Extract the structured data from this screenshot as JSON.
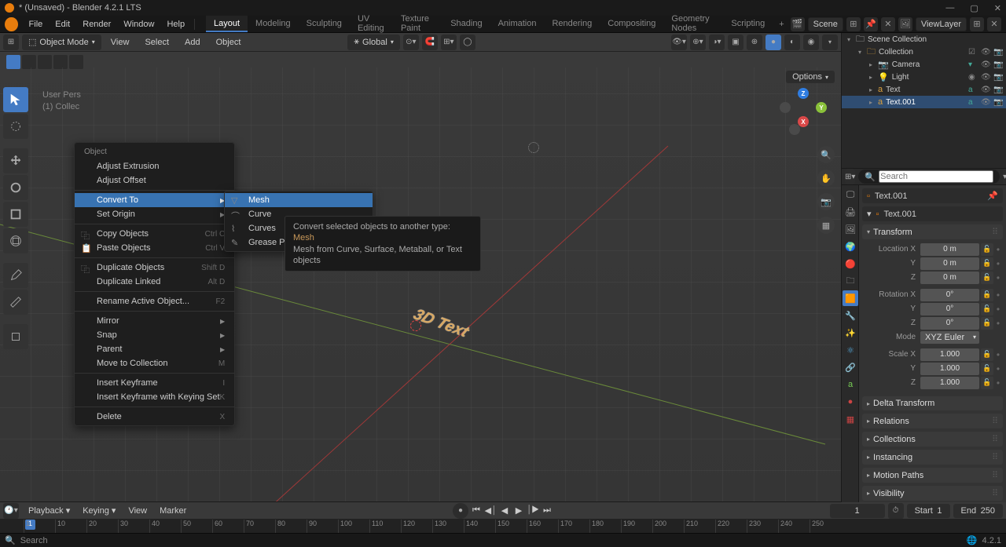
{
  "titlebar": {
    "title": "* (Unsaved) - Blender 4.2.1 LTS"
  },
  "topmenu": {
    "file": "File",
    "edit": "Edit",
    "render": "Render",
    "window": "Window",
    "help": "Help"
  },
  "workspaces": [
    "Layout",
    "Modeling",
    "Sculpting",
    "UV Editing",
    "Texture Paint",
    "Shading",
    "Animation",
    "Rendering",
    "Compositing",
    "Geometry Nodes",
    "Scripting"
  ],
  "active_workspace": 0,
  "scene": {
    "label": "Scene"
  },
  "viewlayer": {
    "label": "ViewLayer"
  },
  "viewport_header": {
    "mode": "Object Mode",
    "menus": [
      "View",
      "Select",
      "Add",
      "Object"
    ],
    "orientation": "Global",
    "options": "Options",
    "search_placeholder": "Search"
  },
  "persp": {
    "line1": "User Pers",
    "line2": "(1) Collec"
  },
  "left_tools": [
    "select-box",
    "cursor",
    "move",
    "rotate",
    "scale",
    "transform",
    "annotate",
    "measure",
    "add-primitive"
  ],
  "ctx_menu": {
    "header": "Object",
    "items_top": [
      {
        "label": "Adjust Extrusion"
      },
      {
        "label": "Adjust Offset"
      }
    ],
    "convert": "Convert To",
    "setorigin": "Set Origin",
    "items_mid": [
      {
        "label": "Copy Objects",
        "shortcut": "Ctrl C",
        "icon": "copy"
      },
      {
        "label": "Paste Objects",
        "shortcut": "Ctrl V",
        "icon": "paste"
      },
      {
        "label": "Duplicate Objects",
        "shortcut": "Shift D",
        "icon": "dup"
      },
      {
        "label": "Duplicate Linked",
        "shortcut": "Alt D"
      },
      {
        "label": "Rename Active Object...",
        "shortcut": "F2"
      }
    ],
    "items_sub": [
      {
        "label": "Mirror"
      },
      {
        "label": "Snap"
      },
      {
        "label": "Parent"
      },
      {
        "label": "Move to Collection",
        "shortcut": "M"
      }
    ],
    "items_key": [
      {
        "label": "Insert Keyframe",
        "shortcut": "I"
      },
      {
        "label": "Insert Keyframe with Keying Set",
        "shortcut": "K"
      }
    ],
    "delete": {
      "label": "Delete",
      "shortcut": "X"
    }
  },
  "submenu": {
    "items": [
      {
        "label": "Mesh",
        "icon": "mesh"
      },
      {
        "label": "Curve",
        "icon": "curve"
      },
      {
        "label": "Curves",
        "icon": "curves"
      },
      {
        "label": "Grease Pencil",
        "icon": "gp"
      }
    ]
  },
  "tooltip": {
    "line1a": "Convert selected objects to another type:  ",
    "line1b": "Mesh",
    "line2": "Mesh from Curve, Surface, Metaball, or Text objects"
  },
  "outliner": {
    "root": "Scene Collection",
    "collection": "Collection",
    "items": [
      {
        "name": "Camera",
        "icon": "camera"
      },
      {
        "name": "Light",
        "icon": "light"
      },
      {
        "name": "Text",
        "icon": "text"
      },
      {
        "name": "Text.001",
        "icon": "text",
        "selected": true
      }
    ]
  },
  "props": {
    "search_placeholder": "Search",
    "breadcrumb1": "Text.001",
    "breadcrumb2": "Text.001",
    "transform": "Transform",
    "location": "Location X",
    "rotation": "Rotation X",
    "scale": "Scale X",
    "y": "Y",
    "z": "Z",
    "mode_label": "Mode",
    "mode_value": "XYZ Euler",
    "loc_vals": [
      "0 m",
      "0 m",
      "0 m"
    ],
    "rot_vals": [
      "0°",
      "0°",
      "0°"
    ],
    "scale_vals": [
      "1.000",
      "1.000",
      "1.000"
    ],
    "sections": [
      "Delta Transform",
      "Relations",
      "Collections",
      "Instancing",
      "Motion Paths",
      "Visibility"
    ]
  },
  "timeline": {
    "playback": "Playback",
    "keying": "Keying",
    "view": "View",
    "marker": "Marker",
    "current": "1",
    "start_label": "Start",
    "start": "1",
    "end_label": "End",
    "end": "250",
    "ticks": [
      "1",
      "10",
      "20",
      "30",
      "40",
      "50",
      "60",
      "70",
      "80",
      "90",
      "100",
      "110",
      "120",
      "130",
      "140",
      "150",
      "160",
      "170",
      "180",
      "190",
      "200",
      "210",
      "220",
      "230",
      "240",
      "250"
    ]
  },
  "statusbar": {
    "search": "Search",
    "version": "4.2.1"
  }
}
